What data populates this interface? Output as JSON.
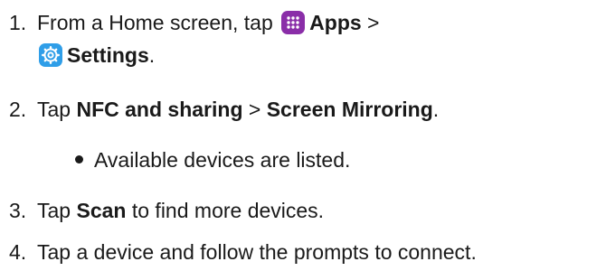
{
  "steps": [
    {
      "number": "1.",
      "prefix": "From a Home screen, tap ",
      "apps_icon": "apps-grid-icon",
      "apps_label": "Apps",
      "separator": " >",
      "settings_icon": "settings-gear-icon",
      "settings_label": "Settings",
      "suffix": "."
    },
    {
      "number": "2.",
      "prefix": "Tap ",
      "bold1": "NFC and sharing",
      "separator": " > ",
      "bold2": "Screen Mirroring",
      "suffix": "."
    },
    {
      "bullet": "Available devices are listed."
    },
    {
      "number": "3.",
      "prefix": "Tap ",
      "bold1": "Scan",
      "suffix": " to find more devices."
    },
    {
      "number": "4.",
      "text": "Tap a device and follow the prompts to connect."
    }
  ],
  "colors": {
    "apps_icon_bg": "#8a2ea8",
    "settings_icon_bg": "#2f9ee8",
    "text": "#1a1a1a"
  }
}
